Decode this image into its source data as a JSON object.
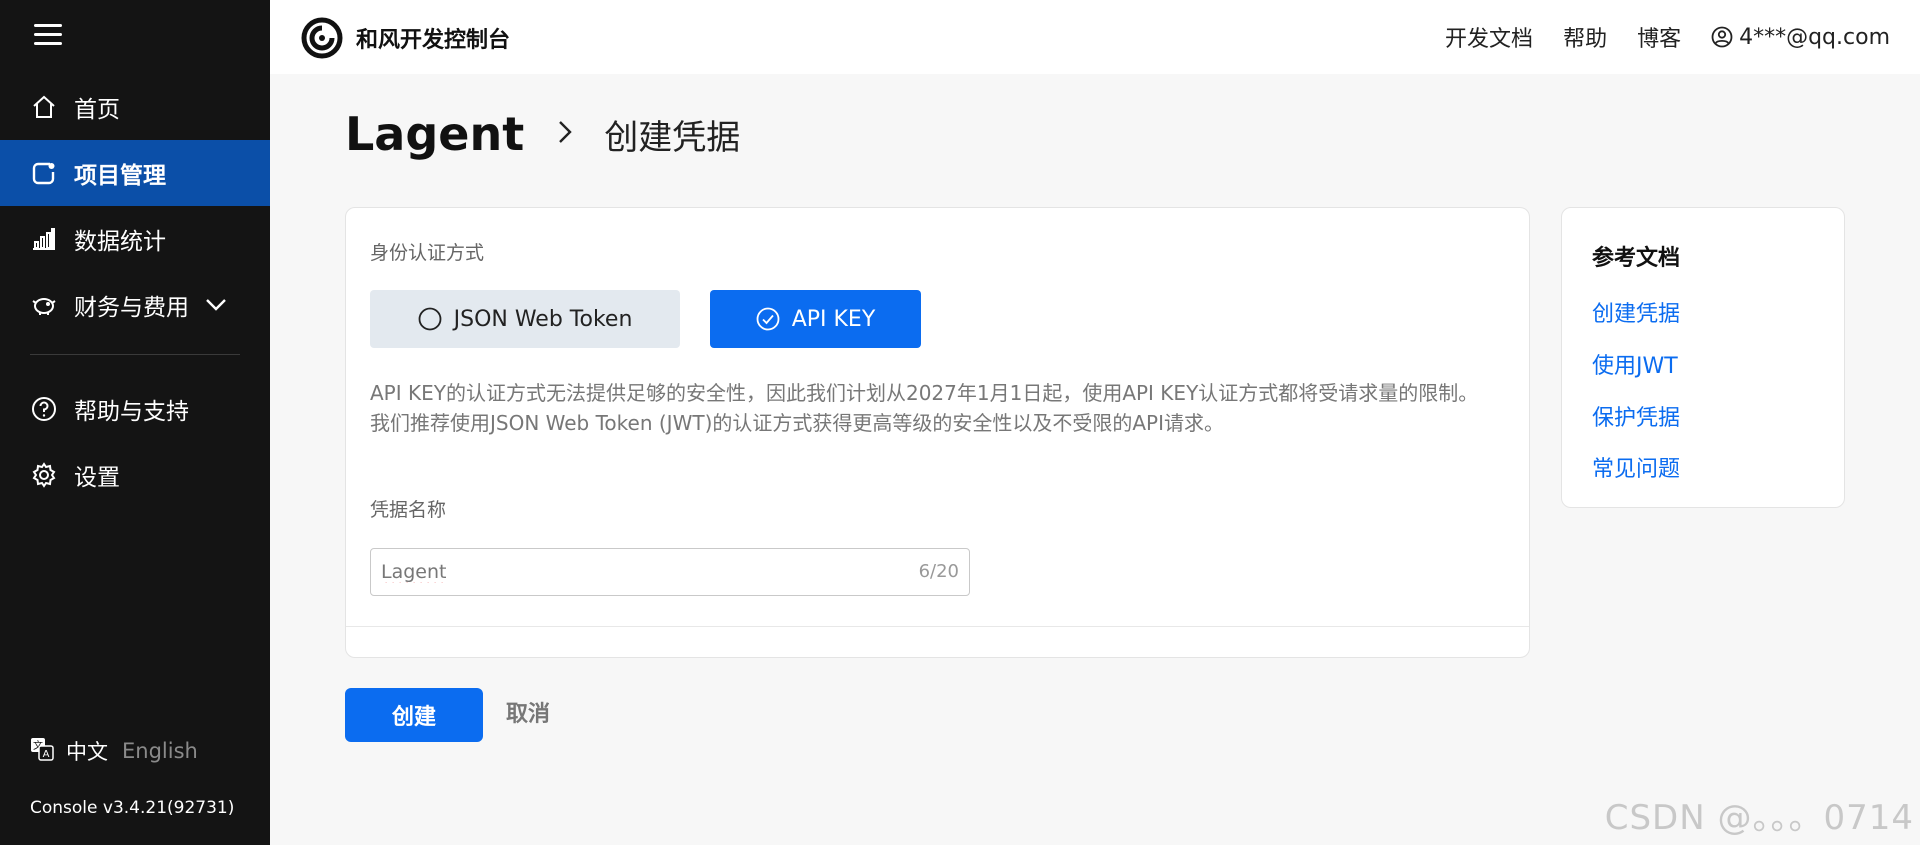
{
  "sidebar": {
    "items": [
      {
        "label": "首页",
        "icon": "home-icon"
      },
      {
        "label": "项目管理",
        "icon": "project-icon",
        "active": true
      },
      {
        "label": "数据统计",
        "icon": "bar-chart-icon"
      },
      {
        "label": "财务与费用",
        "icon": "piggy-bank-icon"
      },
      {
        "label": "帮助与支持",
        "icon": "help-circle-icon"
      },
      {
        "label": "设置",
        "icon": "gear-icon"
      }
    ],
    "lang_zh": "中文",
    "lang_en": "English",
    "version": "Console v3.4.21(92731)"
  },
  "header": {
    "brand": "和风开发控制台",
    "links": [
      "开发文档",
      "帮助",
      "博客"
    ],
    "user": "4***@qq.com"
  },
  "breadcrumb": {
    "root": "Lagent",
    "current": "创建凭据"
  },
  "form": {
    "auth_label": "身份认证方式",
    "auth_options": [
      "JSON Web Token",
      "API KEY"
    ],
    "selected_auth": "API KEY",
    "notice_line1": "API KEY的认证方式无法提供足够的安全性，因此我们计划从2027年1月1日起，使用API KEY认证方式都将受请求量的限制。",
    "notice_line2": "我们推荐使用JSON Web Token (JWT)的认证方式获得更高等级的安全性以及不受限的API请求。",
    "name_label": "凭据名称",
    "name_value": "Lagent",
    "name_counter": "6/20"
  },
  "actions": {
    "create": "创建",
    "cancel": "取消"
  },
  "reference": {
    "title": "参考文档",
    "links": [
      "创建凭据",
      "使用JWT",
      "保护凭据",
      "常见问题"
    ]
  },
  "watermark": "CSDN @。。。0714",
  "colors": {
    "primary": "#0b6cf0",
    "sidebar_bg": "#141414",
    "sidebar_active": "#0b4fa8"
  }
}
